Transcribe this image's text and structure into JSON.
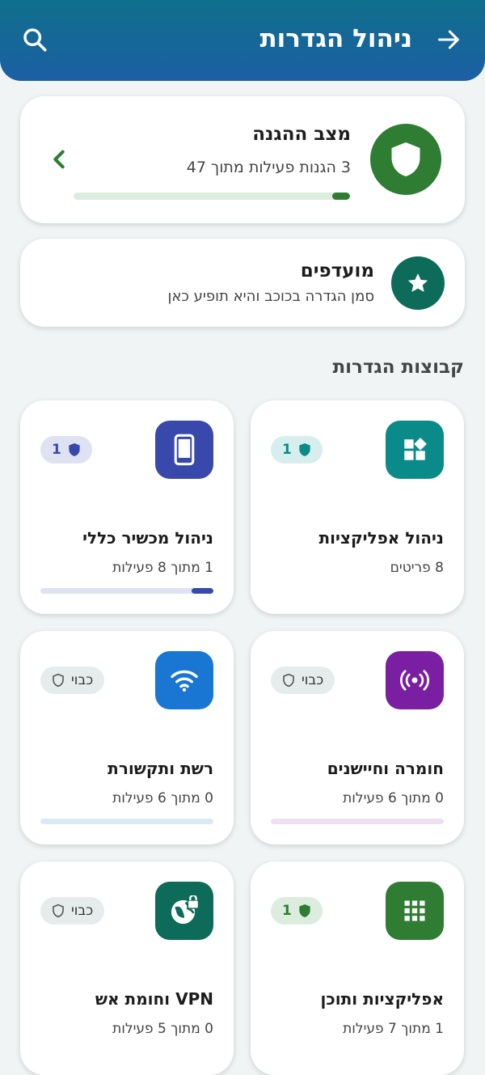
{
  "header": {
    "title": "ניהול הגדרות",
    "back_icon": "arrow-right-icon",
    "search_icon": "search-icon"
  },
  "status": {
    "title": "מצב ההגנה",
    "subtitle": "3 הגנות פעילות מתוך 47",
    "progress": 0.0638,
    "icon": "shield-icon"
  },
  "favorites": {
    "title": "מועדפים",
    "subtitle": "סמן הגדרה בכוכב והיא תופיע כאן",
    "icon": "star-icon"
  },
  "groups_title": "קבוצות הגדרות",
  "tiles": [
    {
      "title": "ניהול אפליקציות",
      "subtitle": "8 פריטים",
      "badge": "1",
      "badge_on": true,
      "progress": null,
      "icon": "widgets-icon",
      "color": "#0b8a8a",
      "badge_bg": "#d6eeee"
    },
    {
      "title": "ניהול מכשיר כללי",
      "subtitle": "1 מתוך 8 פעילות",
      "badge": "1",
      "badge_on": true,
      "progress": 0.125,
      "icon": "smartphone-icon",
      "color": "#3949ab",
      "badge_bg": "#dfe2f3"
    },
    {
      "title": "חומרה וחיישנים",
      "subtitle": "0 מתוך 6 פעילות",
      "badge": "כבוי",
      "badge_on": false,
      "progress": 0,
      "icon": "sensors-icon",
      "color": "#7b1fa2",
      "badge_bg": "#e6ecec"
    },
    {
      "title": "רשת ותקשורת",
      "subtitle": "0 מתוך 6 פעילות",
      "badge": "כבוי",
      "badge_on": false,
      "progress": 0,
      "icon": "wifi-icon",
      "color": "#1976d2",
      "badge_bg": "#e6ecec"
    },
    {
      "title": "אפליקציות ותוכן",
      "subtitle": "1 מתוך 7 פעילות",
      "badge": "1",
      "badge_on": true,
      "progress": null,
      "icon": "apps-grid-icon",
      "color": "#2e7d32",
      "badge_bg": "#dcecdf"
    },
    {
      "title": "VPN וחומת אש",
      "subtitle": "0 מתוך 5 פעילות",
      "badge": "כבוי",
      "badge_on": false,
      "progress": null,
      "icon": "globe-lock-icon",
      "color": "#0d6b5a",
      "badge_bg": "#e6ecec"
    }
  ]
}
